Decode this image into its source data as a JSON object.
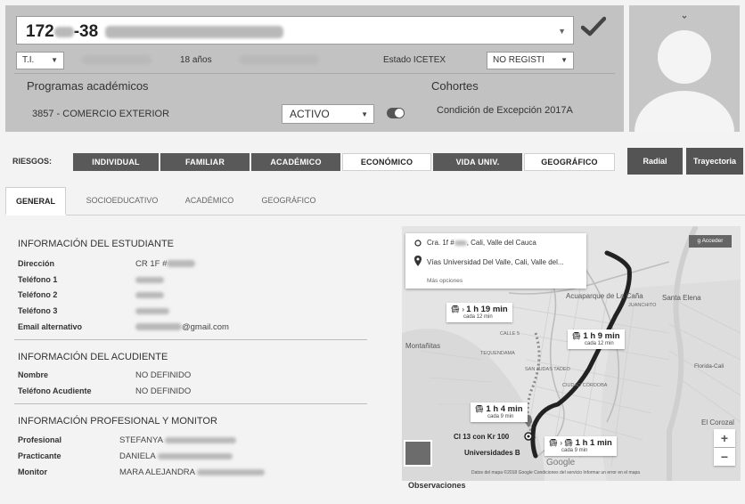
{
  "header": {
    "name_id": "172",
    "name_id_tail": "-38",
    "doc_type": "T.I.",
    "age": "18 años",
    "icetex_label": "Estado ICETEX",
    "icetex_value": "NO REGISTI",
    "programs_label": "Programas académicos",
    "cohorts_label": "Cohortes",
    "program_value": "3857 - COMERCIO EXTERIOR",
    "program_status": "ACTIVO",
    "program_active": true,
    "cohort_value": "Condición de Excepción 2017A"
  },
  "risks": {
    "label": "RIESGOS:",
    "items": [
      {
        "label": "INDIVIDUAL",
        "style": "dark"
      },
      {
        "label": "FAMILIAR",
        "style": "dark"
      },
      {
        "label": "ACADÉMICO",
        "style": "dark"
      },
      {
        "label": "ECONÓMICO",
        "style": "light"
      },
      {
        "label": "VIDA UNIV.",
        "style": "dark"
      },
      {
        "label": "GEOGRÁFICO",
        "style": "light"
      }
    ],
    "actions": [
      "Radial",
      "Trayectoria"
    ]
  },
  "tabs": [
    {
      "label": "GENERAL",
      "active": true
    },
    {
      "label": "SOCIOEDUCATIVO",
      "active": false
    },
    {
      "label": "ACADÉMICO",
      "active": false
    },
    {
      "label": "GEOGRÁFICO",
      "active": false
    }
  ],
  "student": {
    "title": "INFORMACIÓN DEL ESTUDIANTE",
    "labels": [
      "Dirección",
      "Teléfono 1",
      "Teléfono 2",
      "Teléfono 3",
      "Email alternativo"
    ],
    "address_prefix": "CR 1F #",
    "email_suffix": "@gmail.com"
  },
  "guardian": {
    "title": "INFORMACIÓN DEL ACUDIENTE",
    "labels": [
      "Nombre",
      "Teléfono Acudiente"
    ],
    "values": [
      "NO DEFINIDO",
      "NO DEFINIDO"
    ]
  },
  "monitor": {
    "title": "INFORMACIÓN PROFESIONAL Y MONITOR",
    "labels": [
      "Profesional",
      "Practicante",
      "Monitor"
    ],
    "values": [
      "STEFANYA",
      "DANIELA",
      "MARA ALEJANDRA"
    ]
  },
  "map": {
    "origin": "Cra. 1f #",
    "origin_tail": ", Cali, Valle del Cauca",
    "destination": "Vías Universidad Del Valle, Cali, Valle del...",
    "more_options": "Más opciones",
    "sign_in": "Acceder",
    "transit": [
      {
        "time": "1 h 19 min",
        "freq": "cada 12 min"
      },
      {
        "time": "1 h 9 min",
        "freq": "cada 12 min"
      },
      {
        "time": "1 h 4 min",
        "freq": "cada 9 min"
      },
      {
        "time": "1 h 1 min",
        "freq": "cada 9 min"
      }
    ],
    "places": {
      "acuaparque": "Acuaparque de La Caña",
      "santa_elena": "Santa Elena",
      "montanitas": "Montañitas",
      "juanchito": "JUANCHITO",
      "tequendama": "TEQUENDAMA",
      "san_judas": "SAN JUDAS TADEO",
      "ciudad_cordoba": "CIUDAD CÓRDOBA",
      "florida": "Florida-Cali",
      "el_corozal": "El Corozal",
      "cl13": "Cl 13 con Kr 100",
      "univ": "Universidades B",
      "calle5": "Calle 5"
    },
    "footer": "Datos del mapa ©2018 Google    Condiciones del servicio    Informar un error en el mapa",
    "google": "Google"
  },
  "observations_label": "Observaciones",
  "colors": {
    "risk_dark": "#595959",
    "panel_gray": "#c2c2c2",
    "route": "#222222"
  }
}
